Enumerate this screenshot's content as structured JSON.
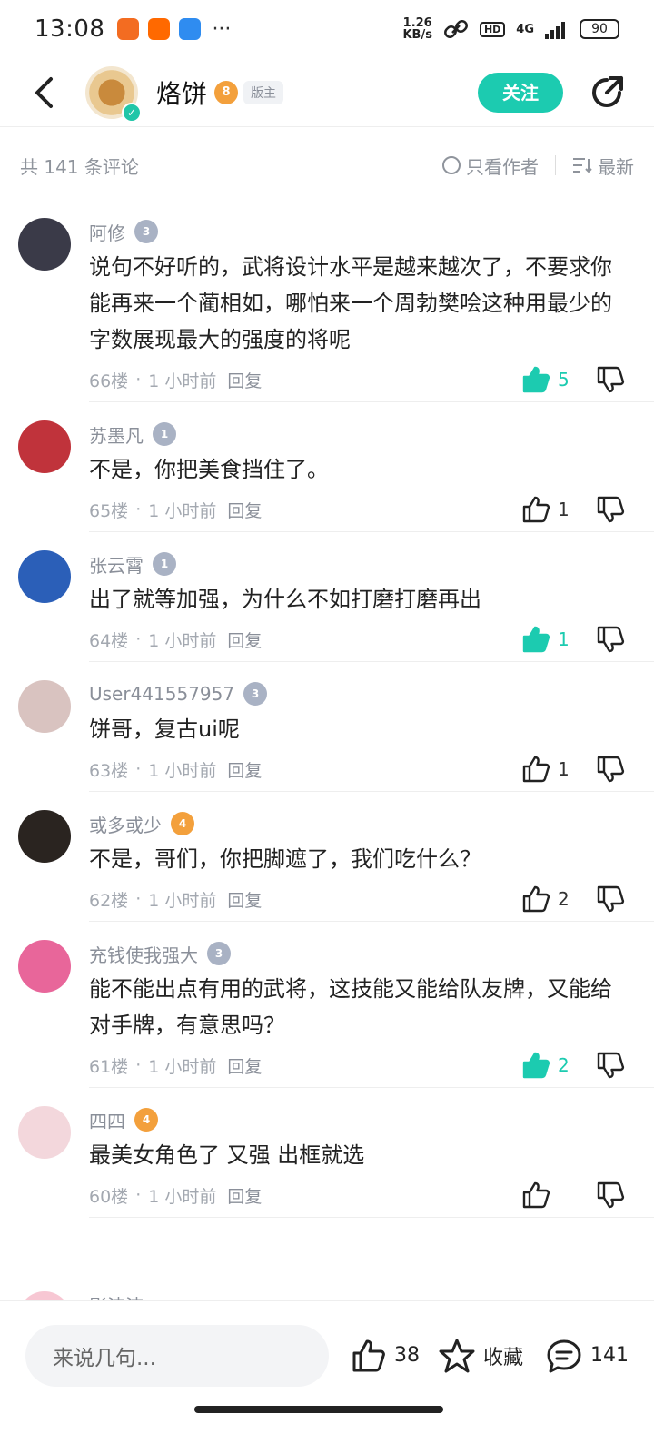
{
  "status": {
    "time": "13:08",
    "net_speed_top": "1.26",
    "net_speed_bottom": "KB/s",
    "hd": "HD",
    "network": "4G",
    "battery": "90"
  },
  "header": {
    "name": "烙饼",
    "level": "8",
    "role_tag": "版主",
    "follow_label": "关注"
  },
  "sub_header": {
    "total": "共 141 条评论",
    "author_only": "只看作者",
    "sort": "最新"
  },
  "comments": [
    {
      "user": "阿修",
      "level": "3",
      "level_color": "gray",
      "text": "说句不好听的，武将设计水平是越来越次了，不要求你能再来一个蔺相如，哪怕来一个周勃樊哙这种用最少的字数展现最大的强度的将呢",
      "floor": "66楼",
      "time": "1 小时前",
      "reply": "回复",
      "likes": "5",
      "liked": true,
      "avatar_color": "#3a3a48"
    },
    {
      "user": "苏墨凡",
      "level": "1",
      "level_color": "gray",
      "text": "不是，你把美食挡住了。",
      "floor": "65楼",
      "time": "1 小时前",
      "reply": "回复",
      "likes": "1",
      "liked": false,
      "avatar_color": "#c0333b"
    },
    {
      "user": "张云霄",
      "level": "1",
      "level_color": "gray",
      "text": "出了就等加强，为什么不如打磨打磨再出",
      "floor": "64楼",
      "time": "1 小时前",
      "reply": "回复",
      "likes": "1",
      "liked": true,
      "avatar_color": "#2b5fb8"
    },
    {
      "user": "User441557957",
      "level": "3",
      "level_color": "gray",
      "text": "饼哥，复古ui呢",
      "floor": "63楼",
      "time": "1 小时前",
      "reply": "回复",
      "likes": "1",
      "liked": false,
      "avatar_color": "#d9c3c0"
    },
    {
      "user": "或多或少",
      "level": "4",
      "level_color": "orange",
      "text": "不是，哥们，你把脚遮了，我们吃什么？",
      "floor": "62楼",
      "time": "1 小时前",
      "reply": "回复",
      "likes": "2",
      "liked": false,
      "avatar_color": "#2a2420"
    },
    {
      "user": "充钱使我强大",
      "level": "3",
      "level_color": "gray",
      "text": "能不能出点有用的武将，这技能又能给队友牌，又能给对手牌，有意思吗？",
      "floor": "61楼",
      "time": "1 小时前",
      "reply": "回复",
      "likes": "2",
      "liked": true,
      "avatar_color": "#e8669a"
    },
    {
      "user": "四四",
      "level": "4",
      "level_color": "orange",
      "text": "最美女角色了 又强 出框就选",
      "floor": "60楼",
      "time": "1 小时前",
      "reply": "回复",
      "likes": "",
      "liked": false,
      "avatar_color": "#f3d7dc"
    }
  ],
  "peek": {
    "user": "影渣渣"
  },
  "bottom_bar": {
    "input_placeholder": "来说几句...",
    "likes": "38",
    "favorite_label": "收藏",
    "comments": "141"
  },
  "colors": {
    "accent": "#1ccbb0",
    "level_gray": "#a9b2c4",
    "level_orange": "#f3a03c"
  }
}
